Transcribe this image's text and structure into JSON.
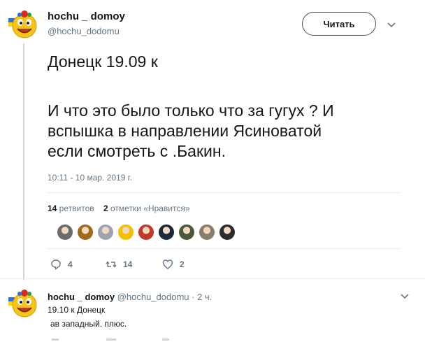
{
  "tweet": {
    "display_name": "hochu _ domoy",
    "handle": "@hochu_dodomu",
    "follow_label": "Читать",
    "text_line1": "Донецк 19.09 к",
    "text_line2": "И что это было только что за гугух ? И",
    "text_line3": "вспышка в направлении Ясиноватой",
    "text_line4": "если смотреть с .Бакин.",
    "timestamp": "10:11 - 10 мар. 2019 г.",
    "retweets_count": "14",
    "retweets_label": "ретвитов",
    "likes_count": "2",
    "likes_label": "отметки «Нравится»",
    "reply_count": "4",
    "retweet_action_count": "14",
    "like_action_count": "2"
  },
  "reply": {
    "display_name": "hochu _ domoy",
    "handle_time": "@hochu_dodomu · 2 ч.",
    "line1": "19.10 к  Донецк",
    "line2": "ав западный. плюс."
  },
  "likers": [
    {
      "name": "liker-avatar-1",
      "color": "#6b6b6b"
    },
    {
      "name": "liker-avatar-2",
      "color": "#a06a1c"
    },
    {
      "name": "liker-avatar-3",
      "color": "#9aa5b1"
    },
    {
      "name": "liker-avatar-4",
      "color": "#f2c200"
    },
    {
      "name": "liker-avatar-5",
      "color": "#c0392b"
    },
    {
      "name": "liker-avatar-6",
      "color": "#1e2a38"
    },
    {
      "name": "liker-avatar-7",
      "color": "#4d5a3a"
    },
    {
      "name": "liker-avatar-8",
      "color": "#8b7d6b"
    },
    {
      "name": "liker-avatar-9",
      "color": "#2c2c2c"
    }
  ],
  "colors": {
    "text_primary": "#14171a",
    "text_secondary": "#657786",
    "divider": "#e6ecf0"
  }
}
